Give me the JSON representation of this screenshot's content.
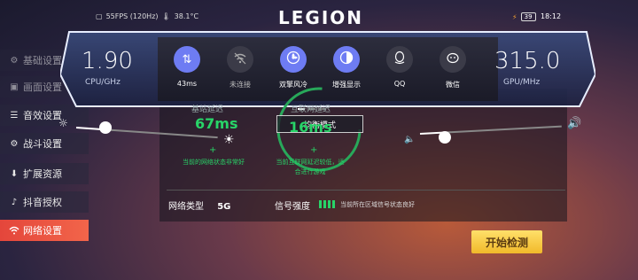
{
  "status": {
    "fps": "55FPS (120Hz)",
    "temp": "38.1°C",
    "brand": "LEGION",
    "battery": "39",
    "time": "18:12"
  },
  "menu": {
    "items": [
      {
        "label": "基础设置"
      },
      {
        "label": "画面设置"
      },
      {
        "label": "音效设置"
      },
      {
        "label": "战斗设置"
      },
      {
        "label": "扩展资源"
      },
      {
        "label": "抖音授权"
      },
      {
        "label": "网络设置"
      }
    ]
  },
  "overlay": {
    "cpu_value": "1.90",
    "cpu_unit": "CPU/GHz",
    "gpu_value": "315.0",
    "gpu_unit": "GPU/MHz",
    "buttons": [
      {
        "label": "43ms",
        "icon": "latency-icon",
        "state": "on"
      },
      {
        "label": "未连接",
        "icon": "wifi-off-icon",
        "state": "off"
      },
      {
        "label": "双擎风冷",
        "icon": "fan-icon",
        "state": "on"
      },
      {
        "label": "增强显示",
        "icon": "contrast-icon",
        "state": "on"
      },
      {
        "label": "QQ",
        "icon": "qq-icon",
        "state": "off"
      },
      {
        "label": "微信",
        "icon": "wechat-icon",
        "state": "off"
      }
    ],
    "brightness_level": 0.2,
    "volume_level": 0.18
  },
  "network": {
    "mode": "均衡模式",
    "base_label": "基站延迟",
    "base_value": "67ms",
    "base_desc": "当前的网络状态非常好",
    "inet_label": "互联网延迟",
    "inet_value": "16ms",
    "inet_desc_1": "当前互联网延迟较低，适",
    "inet_desc_2": "合进行游戏",
    "type_label": "网络类型",
    "type_value": "5G",
    "signal_label": "信号强度",
    "signal_desc": "当前所在区域信号状态良好",
    "start_label": "开始检测"
  }
}
